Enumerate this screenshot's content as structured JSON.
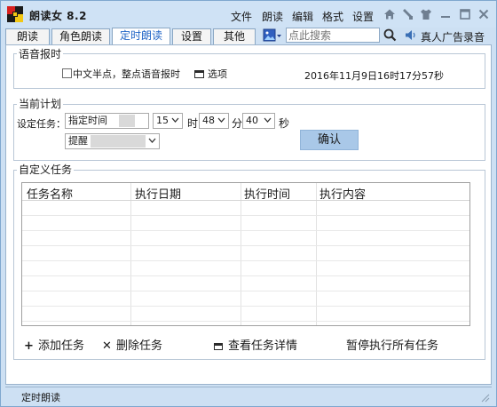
{
  "app": {
    "title": "朗读女 8.2"
  },
  "menu": [
    "文件",
    "朗读",
    "编辑",
    "格式",
    "设置"
  ],
  "tabs": [
    {
      "label": "朗读"
    },
    {
      "label": "角色朗读"
    },
    {
      "label": "定时朗读",
      "active": true
    },
    {
      "label": "设置"
    },
    {
      "label": "其他"
    }
  ],
  "search": {
    "placeholder": "点此搜索"
  },
  "ad_record": "真人广告录音",
  "voice_time": {
    "group_title": "语音报时",
    "half_hour_label": "中文半点，整点语音报时",
    "options_label": "选项",
    "datetime": "2016年11月9日16时17分57秒"
  },
  "plan": {
    "group_title": "当前计划",
    "set_task_label": "设定任务：",
    "task_type": "指定时间",
    "hour": "15",
    "hour_unit": "时",
    "minute": "48",
    "minute_unit": "分",
    "second": "40",
    "second_unit": "秒",
    "action": "提醒",
    "confirm": "确认"
  },
  "custom_tasks": {
    "group_title": "自定义任务",
    "columns": [
      "任务名称",
      "执行日期",
      "执行时间",
      "执行内容"
    ],
    "rows": []
  },
  "actions": {
    "add": "添加任务",
    "delete": "删除任务",
    "details": "查看任务详情",
    "pause_all": "暂停执行所有任务"
  },
  "status": {
    "text": "定时朗读"
  },
  "colors": {
    "accent": "#1e63c6",
    "button": "#a9c8e8",
    "titlebar": "#cfe2f5"
  }
}
